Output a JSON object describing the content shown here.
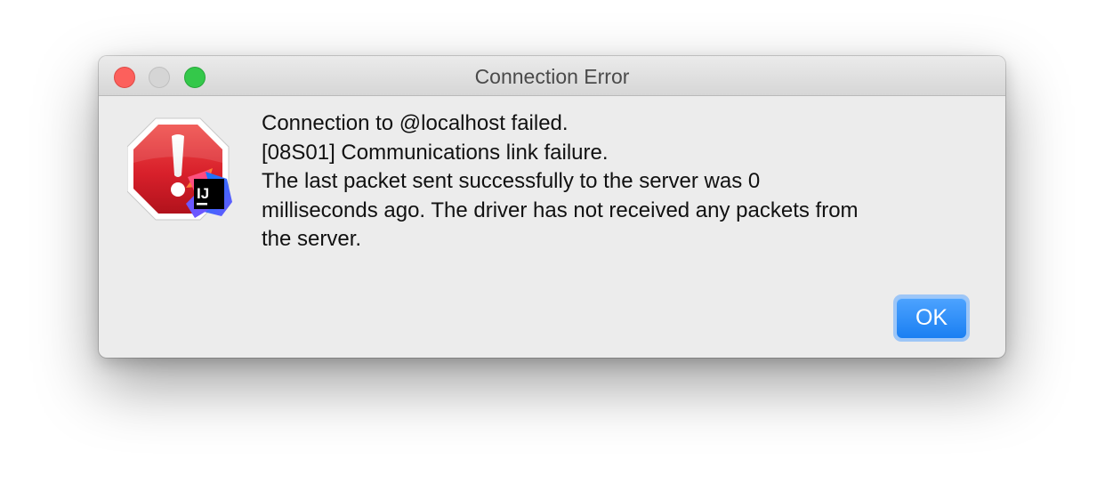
{
  "window": {
    "title": "Connection Error"
  },
  "icons": {
    "alert": "stop-sign-exclamation-icon",
    "app_badge": "intellij-idea-icon",
    "app_badge_text": "IJ"
  },
  "message": {
    "lines": [
      "Connection to @localhost failed.",
      "[08S01] Communications link failure.",
      "The last packet sent successfully to the server was 0",
      "milliseconds ago. The driver has not received any packets from",
      "the server."
    ]
  },
  "buttons": {
    "ok_label": "OK"
  },
  "colors": {
    "accent": "#1a7ff2",
    "close": "#fc605c",
    "zoom": "#34c84a",
    "alert_red": "#d8202b"
  }
}
